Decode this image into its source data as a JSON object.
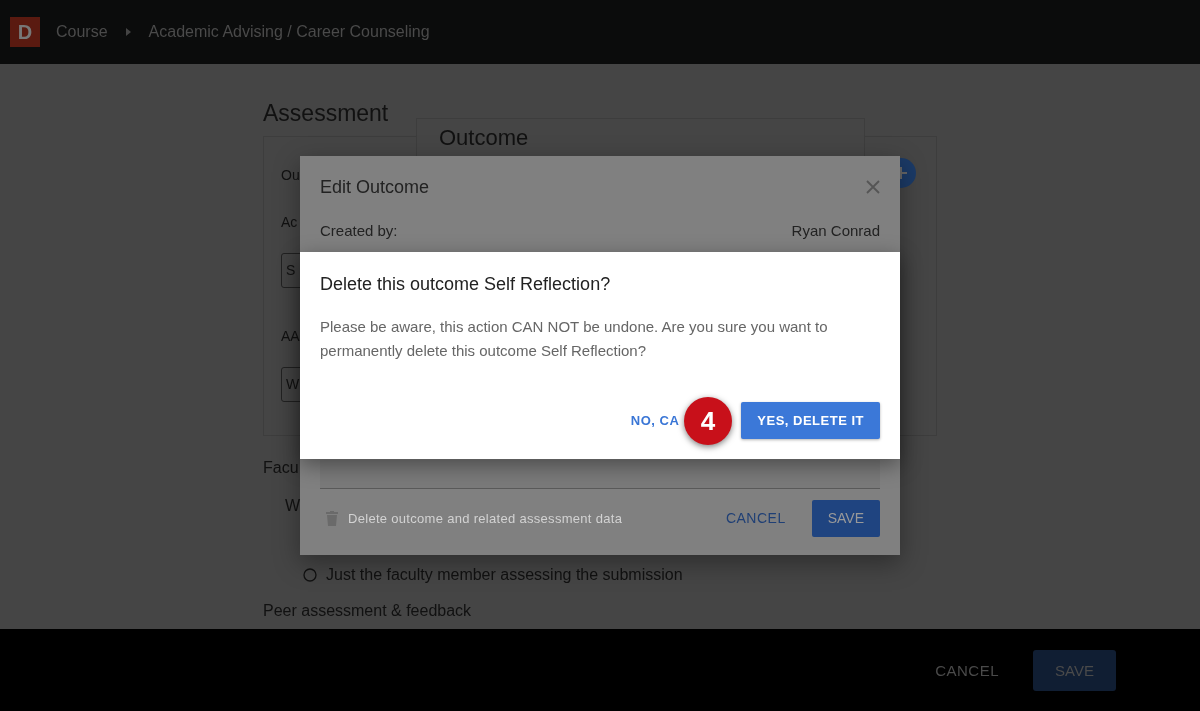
{
  "top_bar": {
    "logo": "D",
    "breadcrumbs": [
      {
        "label": "Course"
      },
      {
        "label": "Academic Advising / Career Counseling"
      }
    ]
  },
  "page": {
    "title": "Assessment",
    "card_items": [
      {
        "kind": "label",
        "text": "Ou"
      },
      {
        "kind": "label",
        "text": "Ac"
      },
      {
        "kind": "input",
        "value": "S"
      },
      {
        "kind": "label",
        "text": "AA"
      },
      {
        "kind": "input",
        "value": "W"
      }
    ],
    "items": [
      {
        "kind": "heading",
        "text": "Facu"
      },
      {
        "kind": "question",
        "text": "W"
      },
      {
        "kind": "radio",
        "text": "Just the faculty member assessing the submission",
        "selected": false
      },
      {
        "kind": "heading",
        "text": "Peer assessment & feedback"
      }
    ]
  },
  "outcome_panel": {
    "title": "Outcome"
  },
  "edit_dialog": {
    "title": "Edit Outcome",
    "created_by_label": "Created by:",
    "created_by": "Ryan Conrad",
    "delete_link": "Delete outcome and related assessment data",
    "cancel": "CANCEL",
    "save": "SAVE"
  },
  "confirm_dialog": {
    "title": "Delete this outcome Self Reflection?",
    "message": "Please be aware, this action CAN NOT be undone. Are you sure you want to permanently delete this outcome Self Reflection?",
    "cancel": "NO, CA",
    "confirm": "YES, DELETE IT"
  },
  "step_badge": {
    "number": "4"
  },
  "footer": {
    "cancel": "CANCEL",
    "save": "SAVE"
  }
}
